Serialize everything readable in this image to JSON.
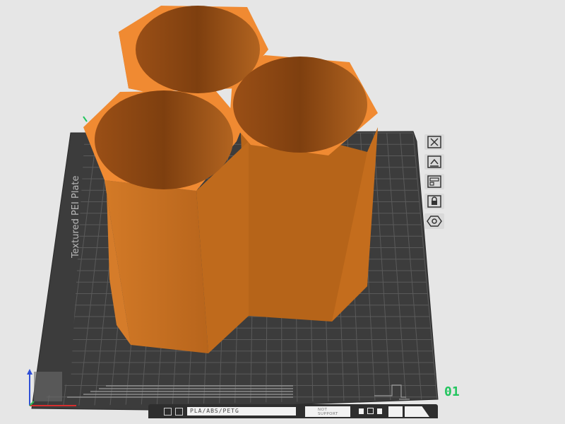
{
  "plate": {
    "name": "Textured PEI Plate",
    "number": "01"
  },
  "bottom_bar": {
    "filament": "PLA/ABS/PETG",
    "surface_line1": "NOT",
    "surface_line2": "SUPPORT"
  },
  "toolbar": {
    "icons": [
      "close-icon",
      "auto-orient-icon",
      "arrange-icon",
      "lock-icon",
      "plate-settings-icon"
    ]
  },
  "colors": {
    "background": "#e6e6e6",
    "plate": "#3e3e3e",
    "grid": "#5e5e5e",
    "model_top": "#f08a32",
    "model_side": "#c8701f",
    "plate_number": "#22c55e"
  }
}
